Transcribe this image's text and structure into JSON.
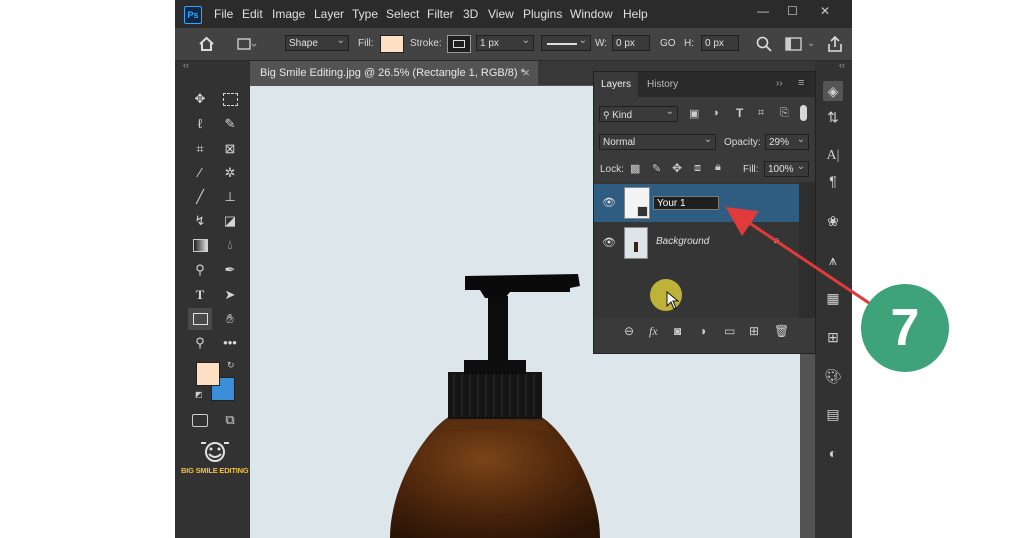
{
  "app": {
    "logo": "Ps"
  },
  "menu": [
    "File",
    "Edit",
    "Image",
    "Layer",
    "Type",
    "Select",
    "Filter",
    "3D",
    "View",
    "Plugins",
    "Window",
    "Help"
  ],
  "window_controls": [
    "—",
    "☐",
    "✕"
  ],
  "options_bar": {
    "mode": "Shape",
    "fill_label": "Fill:",
    "stroke_label": "Stroke:",
    "stroke_width": "1 px",
    "w_label": "W:",
    "w_value": "0 px",
    "link_label": "GO",
    "h_label": "H:",
    "h_value": "0 px",
    "fill_color": "#fde0c4"
  },
  "document_tab": {
    "title": "Big Smile Editing.jpg @ 26.5% (Rectangle 1, RGB/8) *",
    "close": "×"
  },
  "toolbar": {
    "collapse": "‹‹",
    "foreground_color": "#fde0c4",
    "background_color": "#3b8fd9",
    "brand_text": "BIG SMILE EDITING"
  },
  "layers_panel": {
    "tabs": [
      "Layers",
      "History"
    ],
    "filter_label": "Kind",
    "blend_mode": "Normal",
    "opacity_label": "Opacity:",
    "opacity_value": "29%",
    "lock_label": "Lock:",
    "fill_label": "Fill:",
    "fill_value": "100%",
    "layers": [
      {
        "name": "Your 1",
        "selected": true,
        "editing": true
      },
      {
        "name": "Background",
        "selected": false,
        "locked": true
      }
    ],
    "footer_icons": [
      "link-icon",
      "fx-icon",
      "mask-icon",
      "adjustment-icon",
      "folder-icon",
      "new-layer-icon",
      "trash-icon"
    ],
    "fx_label": "fx"
  },
  "annotation": {
    "step_number": "7",
    "badge_color": "#3ea37a",
    "arrow_color": "#e03a3a"
  },
  "colors": {
    "selected_layer": "#2f5d82",
    "cursor_highlight": "#e2d23a"
  }
}
